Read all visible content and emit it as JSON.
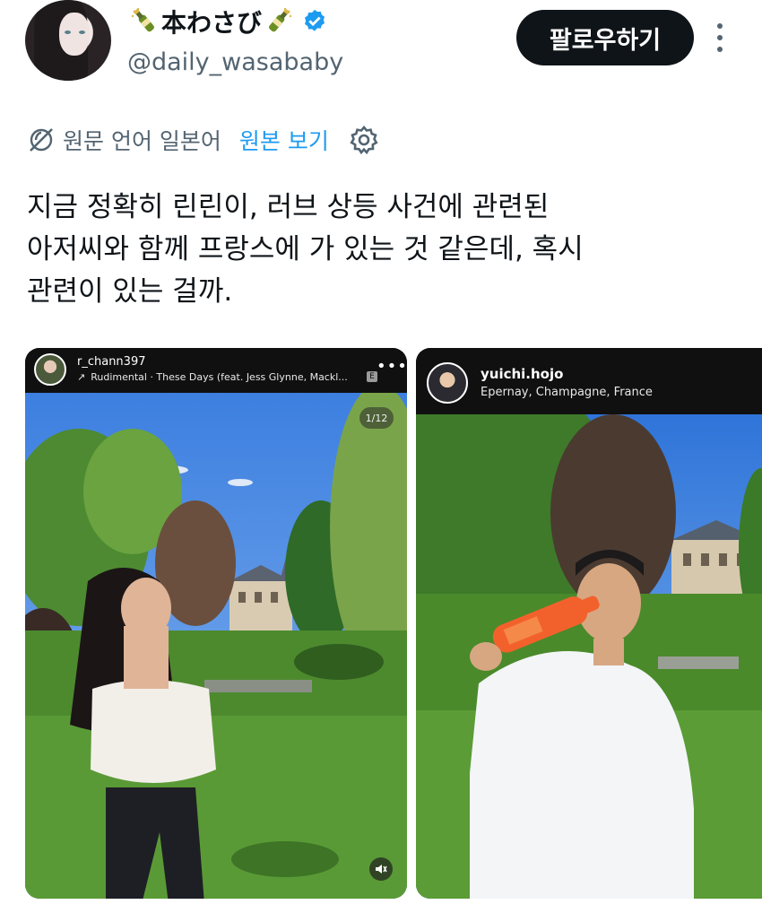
{
  "profile": {
    "display_name": "本わさび",
    "handle": "@daily_wasababy",
    "verified": true,
    "avatar": "avatar"
  },
  "actions": {
    "follow_label": "팔로우하기",
    "more_icon": "more-vertical-icon"
  },
  "translation": {
    "icon": "globe-slash-icon",
    "source_language": "원문 언어 일본어",
    "view_original_label": "원본 보기",
    "settings_icon": "gear-icon"
  },
  "tweet": {
    "lines": [
      "지금 정확히 린린이, 러브 상등 사건에 관련된",
      "아저씨와 함께 프랑스에 가 있는 것 같은데, 혹시",
      "관련이 있는 걸까."
    ]
  },
  "media": [
    {
      "username": "r_chann397",
      "subtitle": "Rudimental · These Days (feat. Jess Glynne, Mackl...",
      "explicit": "E",
      "page_counter": "1/12",
      "mute_icon": "mute-icon"
    },
    {
      "username": "yuichi.hojo",
      "subtitle": "Epernay, Champagne, France"
    }
  ],
  "colors": {
    "link": "#1d9bf0",
    "secondary_text": "#536471",
    "primary_text": "#0f1419",
    "follow_button_bg": "#0f1419"
  }
}
